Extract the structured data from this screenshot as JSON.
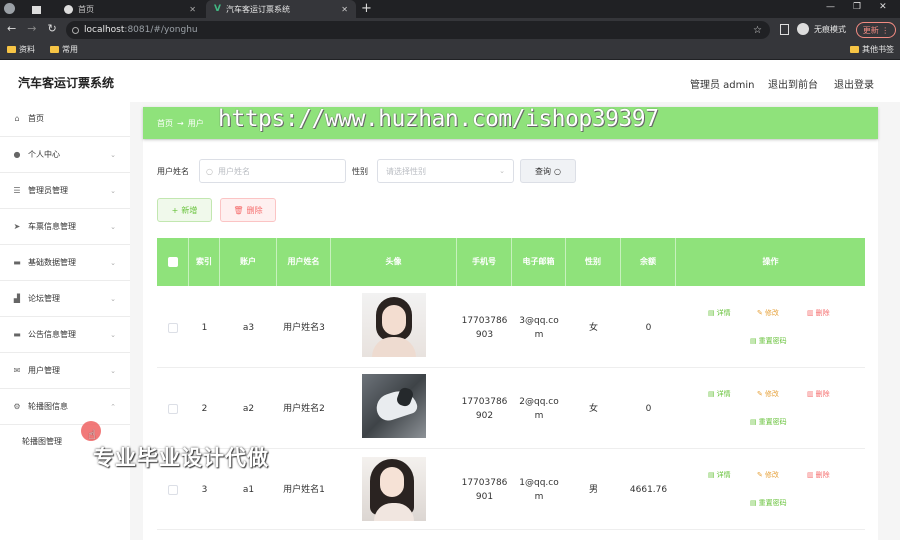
{
  "browser": {
    "tabs": [
      {
        "label": "首页"
      },
      {
        "label": "汽车客运订票系统"
      }
    ],
    "url_host": "localhost",
    "url_rest": ":8081/#/yonghu",
    "incognito_label": "无痕模式",
    "update_label": "更新",
    "bookmarks": [
      "资料",
      "常用"
    ],
    "other_bookmarks": "其他书签"
  },
  "app": {
    "title": "汽车客运订票系统",
    "header_links": [
      "管理员 admin",
      "退出到前台",
      "退出登录"
    ]
  },
  "sidebar": {
    "items": [
      {
        "label": "首页",
        "icon": "home-icon"
      },
      {
        "label": "个人中心",
        "icon": "user-icon"
      },
      {
        "label": "管理员管理",
        "icon": "list-icon"
      },
      {
        "label": "车票信息管理",
        "icon": "send-icon"
      },
      {
        "label": "基础数据管理",
        "icon": "monitor-icon"
      },
      {
        "label": "论坛管理",
        "icon": "chart-icon"
      },
      {
        "label": "公告信息管理",
        "icon": "monitor-icon"
      },
      {
        "label": "用户管理",
        "icon": "mail-icon"
      },
      {
        "label": "轮播图信息",
        "icon": "gear-icon"
      }
    ],
    "subitem": "轮播图管理"
  },
  "breadcrumb": {
    "home": "首页",
    "arrow": "→",
    "current": "用户"
  },
  "watermark": "https://www.huzhan.com/ishop39397",
  "promo": "专业毕业设计代做",
  "search": {
    "name_label": "用户姓名",
    "name_placeholder": "用户姓名",
    "gender_label": "性别",
    "gender_placeholder": "请选择性别",
    "query_button": "查询"
  },
  "toolbar": {
    "add": "新增",
    "delete": "删除"
  },
  "table": {
    "headers": [
      "索引",
      "账户",
      "用户姓名",
      "头像",
      "手机号",
      "电子邮箱",
      "性别",
      "余额",
      "操作"
    ],
    "rows": [
      {
        "index": "1",
        "account": "a3",
        "name": "用户姓名3",
        "phone": "17703786903",
        "phone_a": "17703786",
        "phone_b": "903",
        "email_a": "3@qq.co",
        "email_b": "m",
        "gender": "女",
        "balance": "0"
      },
      {
        "index": "2",
        "account": "a2",
        "name": "用户姓名2",
        "phone_a": "17703786",
        "phone_b": "902",
        "email_a": "2@qq.co",
        "email_b": "m",
        "gender": "女",
        "balance": "0"
      },
      {
        "index": "3",
        "account": "a1",
        "name": "用户姓名1",
        "phone_a": "17703786",
        "phone_b": "901",
        "email_a": "1@qq.co",
        "email_b": "m",
        "gender": "男",
        "balance": "4661.76"
      }
    ],
    "actions": {
      "detail": "详情",
      "edit": "修改",
      "delete": "删除",
      "reset": "重置密码"
    }
  },
  "colors": {
    "accent": "#8fe27b",
    "edit": "#e6a23c",
    "danger": "#f56c6c",
    "success": "#67c23a"
  }
}
